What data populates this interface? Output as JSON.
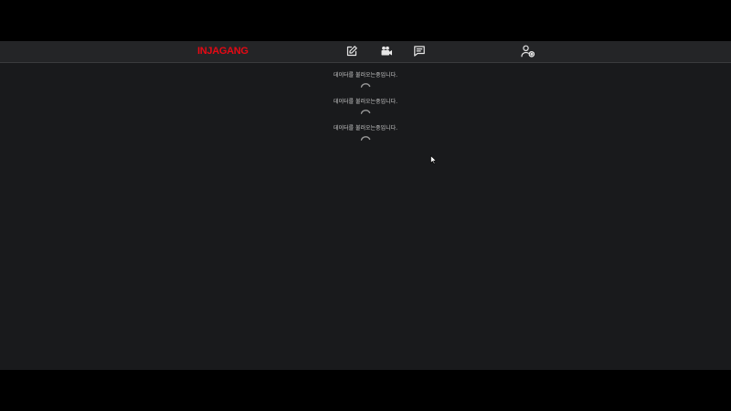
{
  "header": {
    "logo_text": "INJAGANG",
    "nav": [
      {
        "icon": "edit-icon"
      },
      {
        "icon": "video-camera-icon"
      },
      {
        "icon": "message-icon"
      },
      {
        "icon": "user-settings-icon"
      }
    ]
  },
  "loading_items": [
    {
      "text": "데이터를 불러오는중입니다."
    },
    {
      "text": "데이터를 불러오는중입니다."
    },
    {
      "text": "데이터를 불러오는중입니다."
    }
  ],
  "colors": {
    "brand": "#e50914",
    "header_bg": "#242527",
    "page_bg": "#191a1c",
    "letterbox": "#000000"
  }
}
